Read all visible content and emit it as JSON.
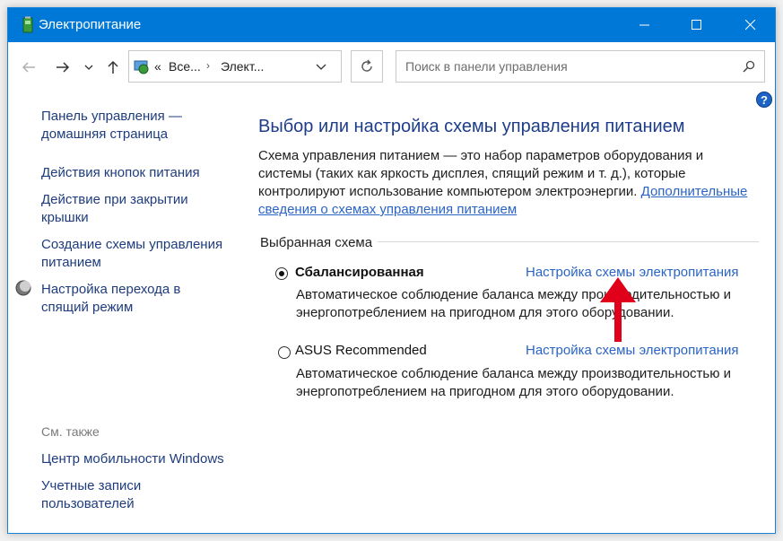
{
  "window": {
    "title": "Электропитание",
    "controls": [
      "minimize",
      "maximize",
      "close"
    ]
  },
  "address_bar": {
    "prefix": "«",
    "breadcrumbs": [
      "Все...",
      "Элект..."
    ],
    "search_placeholder": "Поиск в панели управления"
  },
  "sidebar": {
    "links": [
      {
        "label_1": "Панель управления —",
        "label_2": "домашняя страница"
      },
      {
        "label_1": "Действия кнопок питания"
      },
      {
        "label_1": "Действие при закрытии",
        "label_2": "крышки"
      },
      {
        "label_1": "Создание схемы управления",
        "label_2": "питанием"
      },
      {
        "label_1": "Настройка перехода в",
        "label_2": "спящий режим",
        "icon": "sleep-moon-icon"
      }
    ],
    "see_also_label": "См. также",
    "see_also": [
      {
        "label_1": "Центр мобильности Windows"
      },
      {
        "label_1": "Учетные записи",
        "label_2": "пользователей"
      }
    ]
  },
  "main": {
    "heading": "Выбор или настройка схемы управления питанием",
    "description_1": "Схема управления питанием — это набор параметров оборудования и",
    "description_2": "системы (таких как яркость дисплея, спящий режим и т. д.), которые",
    "description_3": "контролируют использование компьютером электроэнергии.",
    "description_link_1": "Дополнительные",
    "description_link_2": "сведения о схемах управления питанием",
    "group_label": "Выбранная схема",
    "plans": [
      {
        "name": "Сбалансированная",
        "selected": true,
        "link": "Настройка схемы электропитания",
        "desc_1": "Автоматическое соблюдение баланса между производительностью и",
        "desc_2": "энергопотреблением на пригодном для этого оборудовании."
      },
      {
        "name": "ASUS Recommended",
        "selected": false,
        "link": "Настройка схемы электропитания",
        "desc_1": "Автоматическое соблюдение баланса между производительностью и",
        "desc_2": "энергопотреблением на пригодном для этого оборудовании."
      }
    ]
  },
  "colors": {
    "titlebar": "#0078d7",
    "heading": "#1d3d8a",
    "link": "#2a64c5",
    "annotation_arrow": "#e0001a"
  }
}
